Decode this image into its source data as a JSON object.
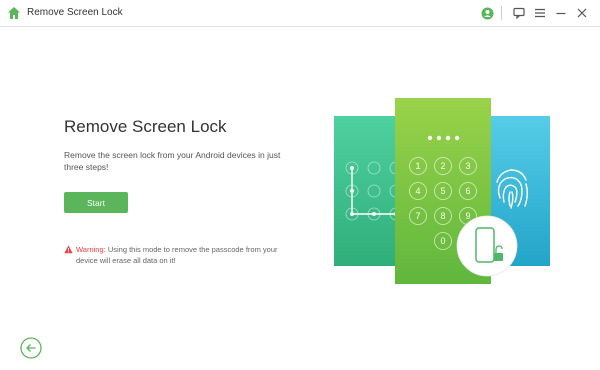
{
  "app": {
    "title": "Remove Screen Lock"
  },
  "icons": {
    "home": "home-icon",
    "account": "account-icon",
    "feedback": "feedback-icon",
    "menu": "menu-icon",
    "minimize": "minimize-icon",
    "close": "close-icon",
    "warning": "warning-icon",
    "back": "back-arrow-icon"
  },
  "main": {
    "title": "Remove Screen Lock",
    "description": "Remove the screen lock from your Android devices in just three steps!",
    "start_label": "Start",
    "warning_label": "Warning:",
    "warning_text": "Using this mode to remove the passcode from your device will erase all data on it!"
  },
  "illustration": {
    "pin_keys": [
      "1",
      "2",
      "3",
      "4",
      "5",
      "6",
      "7",
      "8",
      "9",
      "0"
    ]
  },
  "colors": {
    "accent": "#5bb55a",
    "warning": "#e84141",
    "panel_left": "#3dbf8e",
    "panel_mid": "#7cc242",
    "panel_right": "#33b8d7"
  }
}
